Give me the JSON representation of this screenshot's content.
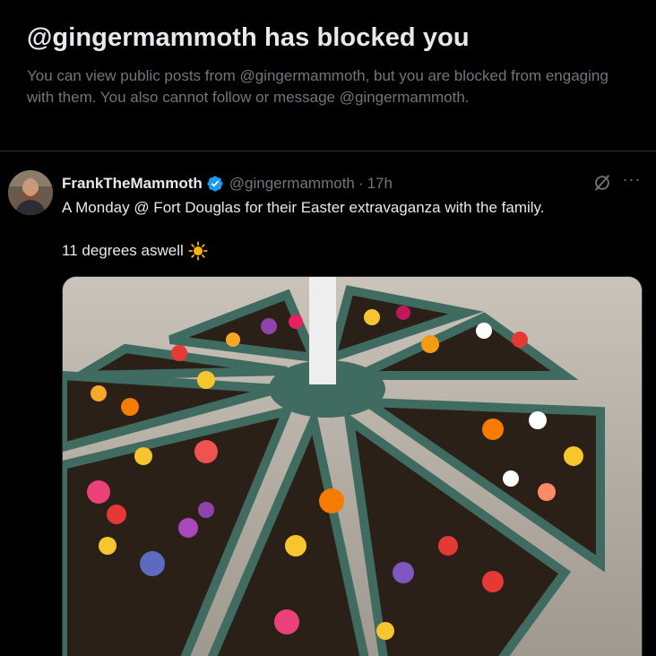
{
  "blocked": {
    "title": "@gingermammoth has blocked you",
    "description": "You can view public posts from @gingermammoth, but you are blocked from engaging with them. You also cannot follow or message @gingermammoth."
  },
  "post": {
    "display_name": "FrankTheMammoth",
    "verified": true,
    "handle": "@gingermammoth",
    "separator": "·",
    "time": "17h",
    "text_line1": "A Monday @ Fort Douglas for their Easter extravaganza with the family.",
    "text_line2": "11 degrees aswell",
    "emoji": "sun-icon",
    "more_label": "···"
  },
  "colors": {
    "background": "#000000",
    "text_primary": "#e7e9ea",
    "text_secondary": "#71767b",
    "verified": "#1d9bf0",
    "divider": "#2f3336",
    "planter": "#3f6b61"
  }
}
